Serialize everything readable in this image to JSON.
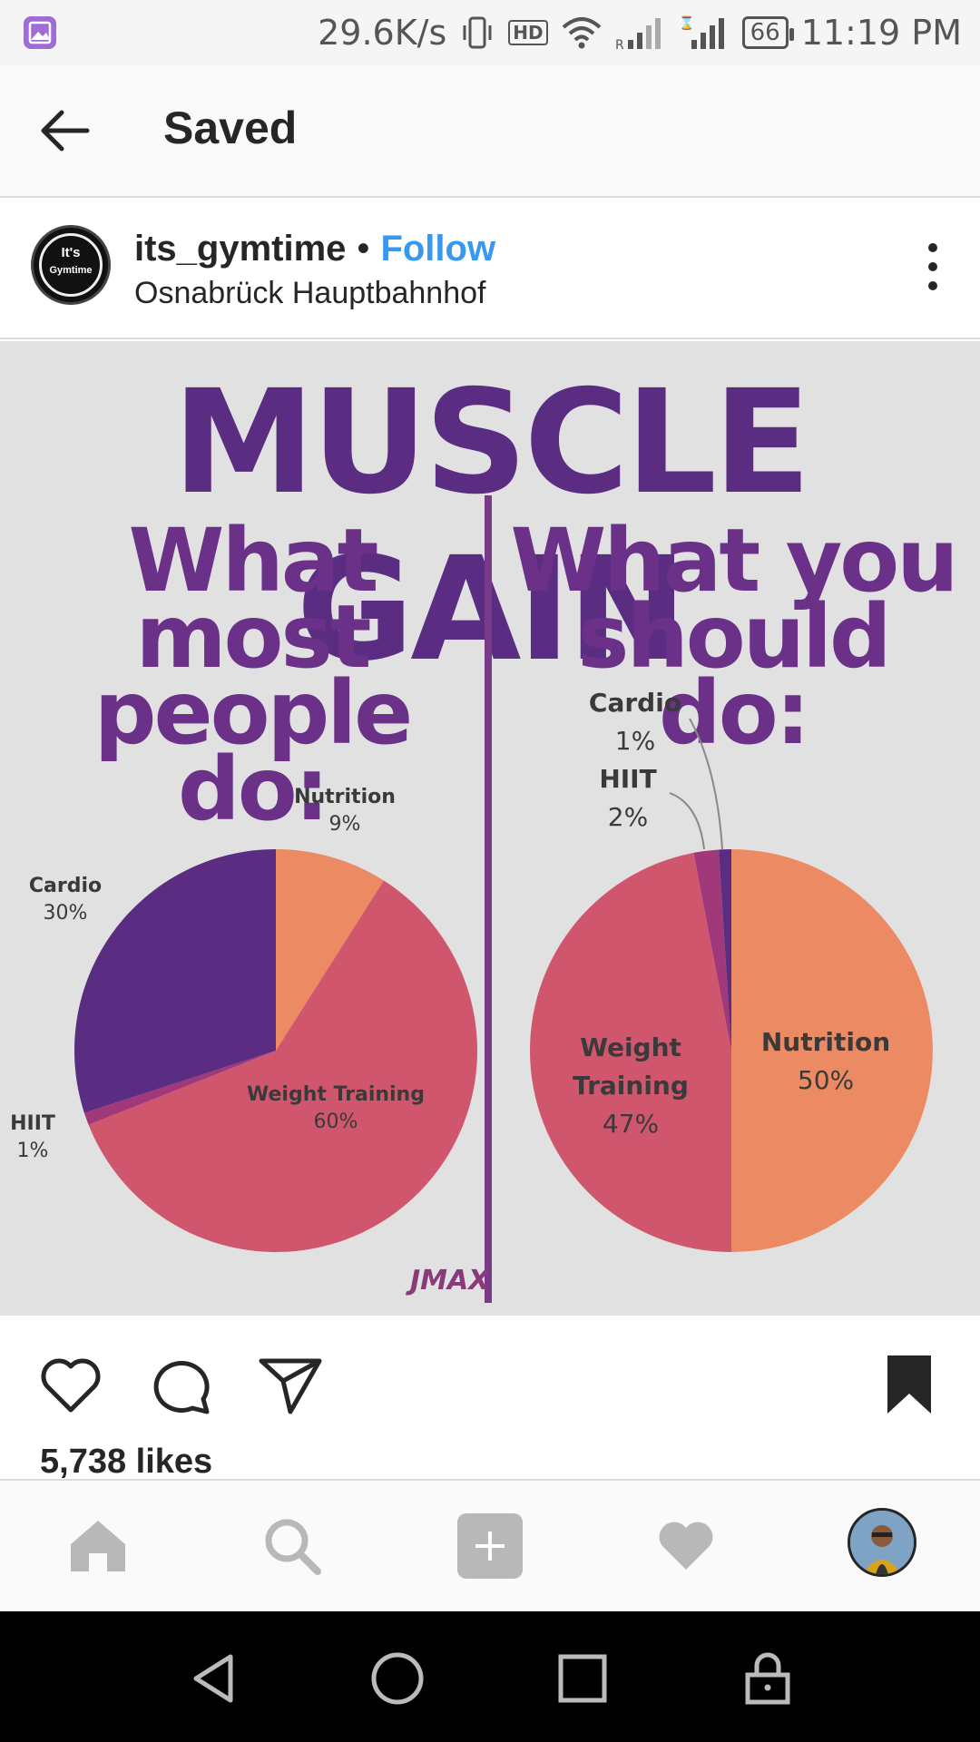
{
  "status_bar": {
    "speed": "29.6K/s",
    "hd": "HD",
    "battery": "66",
    "time": "11:19 PM"
  },
  "header": {
    "title": "Saved"
  },
  "post": {
    "username": "its_gymtime",
    "separator": "•",
    "follow_label": "Follow",
    "location": "Osnabrück Hauptbahnhof",
    "avatar_text_1": "It's",
    "avatar_text_2": "Gymtime",
    "likes": "5,738 likes"
  },
  "image": {
    "title": "MUSCLE GAIN",
    "left_heading_line1": "What most",
    "left_heading_line2": "people do:",
    "right_heading_line1": "What you",
    "right_heading_line2": "should do:",
    "watermark": "JMAX"
  },
  "chart_data": [
    {
      "type": "pie",
      "title": "What most people do:",
      "labels": [
        "Nutrition",
        "Weight Training",
        "HIIT",
        "Cardio"
      ],
      "values": [
        9,
        60,
        1,
        30
      ],
      "value_labels": [
        "9%",
        "60%",
        "1%",
        "30%"
      ],
      "colors": [
        "#ec8a63",
        "#d0566d",
        "#a0387a",
        "#5a2d82"
      ]
    },
    {
      "type": "pie",
      "title": "What you should do:",
      "labels": [
        "Nutrition",
        "Weight Training",
        "HIIT",
        "Cardio"
      ],
      "values": [
        50,
        47,
        2,
        1
      ],
      "value_labels": [
        "50%",
        "47%",
        "2%",
        "1%"
      ],
      "colors": [
        "#ec8a63",
        "#d0566d",
        "#a0387a",
        "#5a2d82"
      ]
    }
  ],
  "icons": {
    "back": "arrow-left-icon",
    "more": "more-vertical-icon",
    "like": "heart-icon",
    "comment": "comment-icon",
    "share": "send-icon",
    "save": "bookmark-icon",
    "home": "home-icon",
    "search": "search-icon",
    "add": "add-icon",
    "activity": "heart-filled-icon",
    "profile": "profile-avatar"
  }
}
